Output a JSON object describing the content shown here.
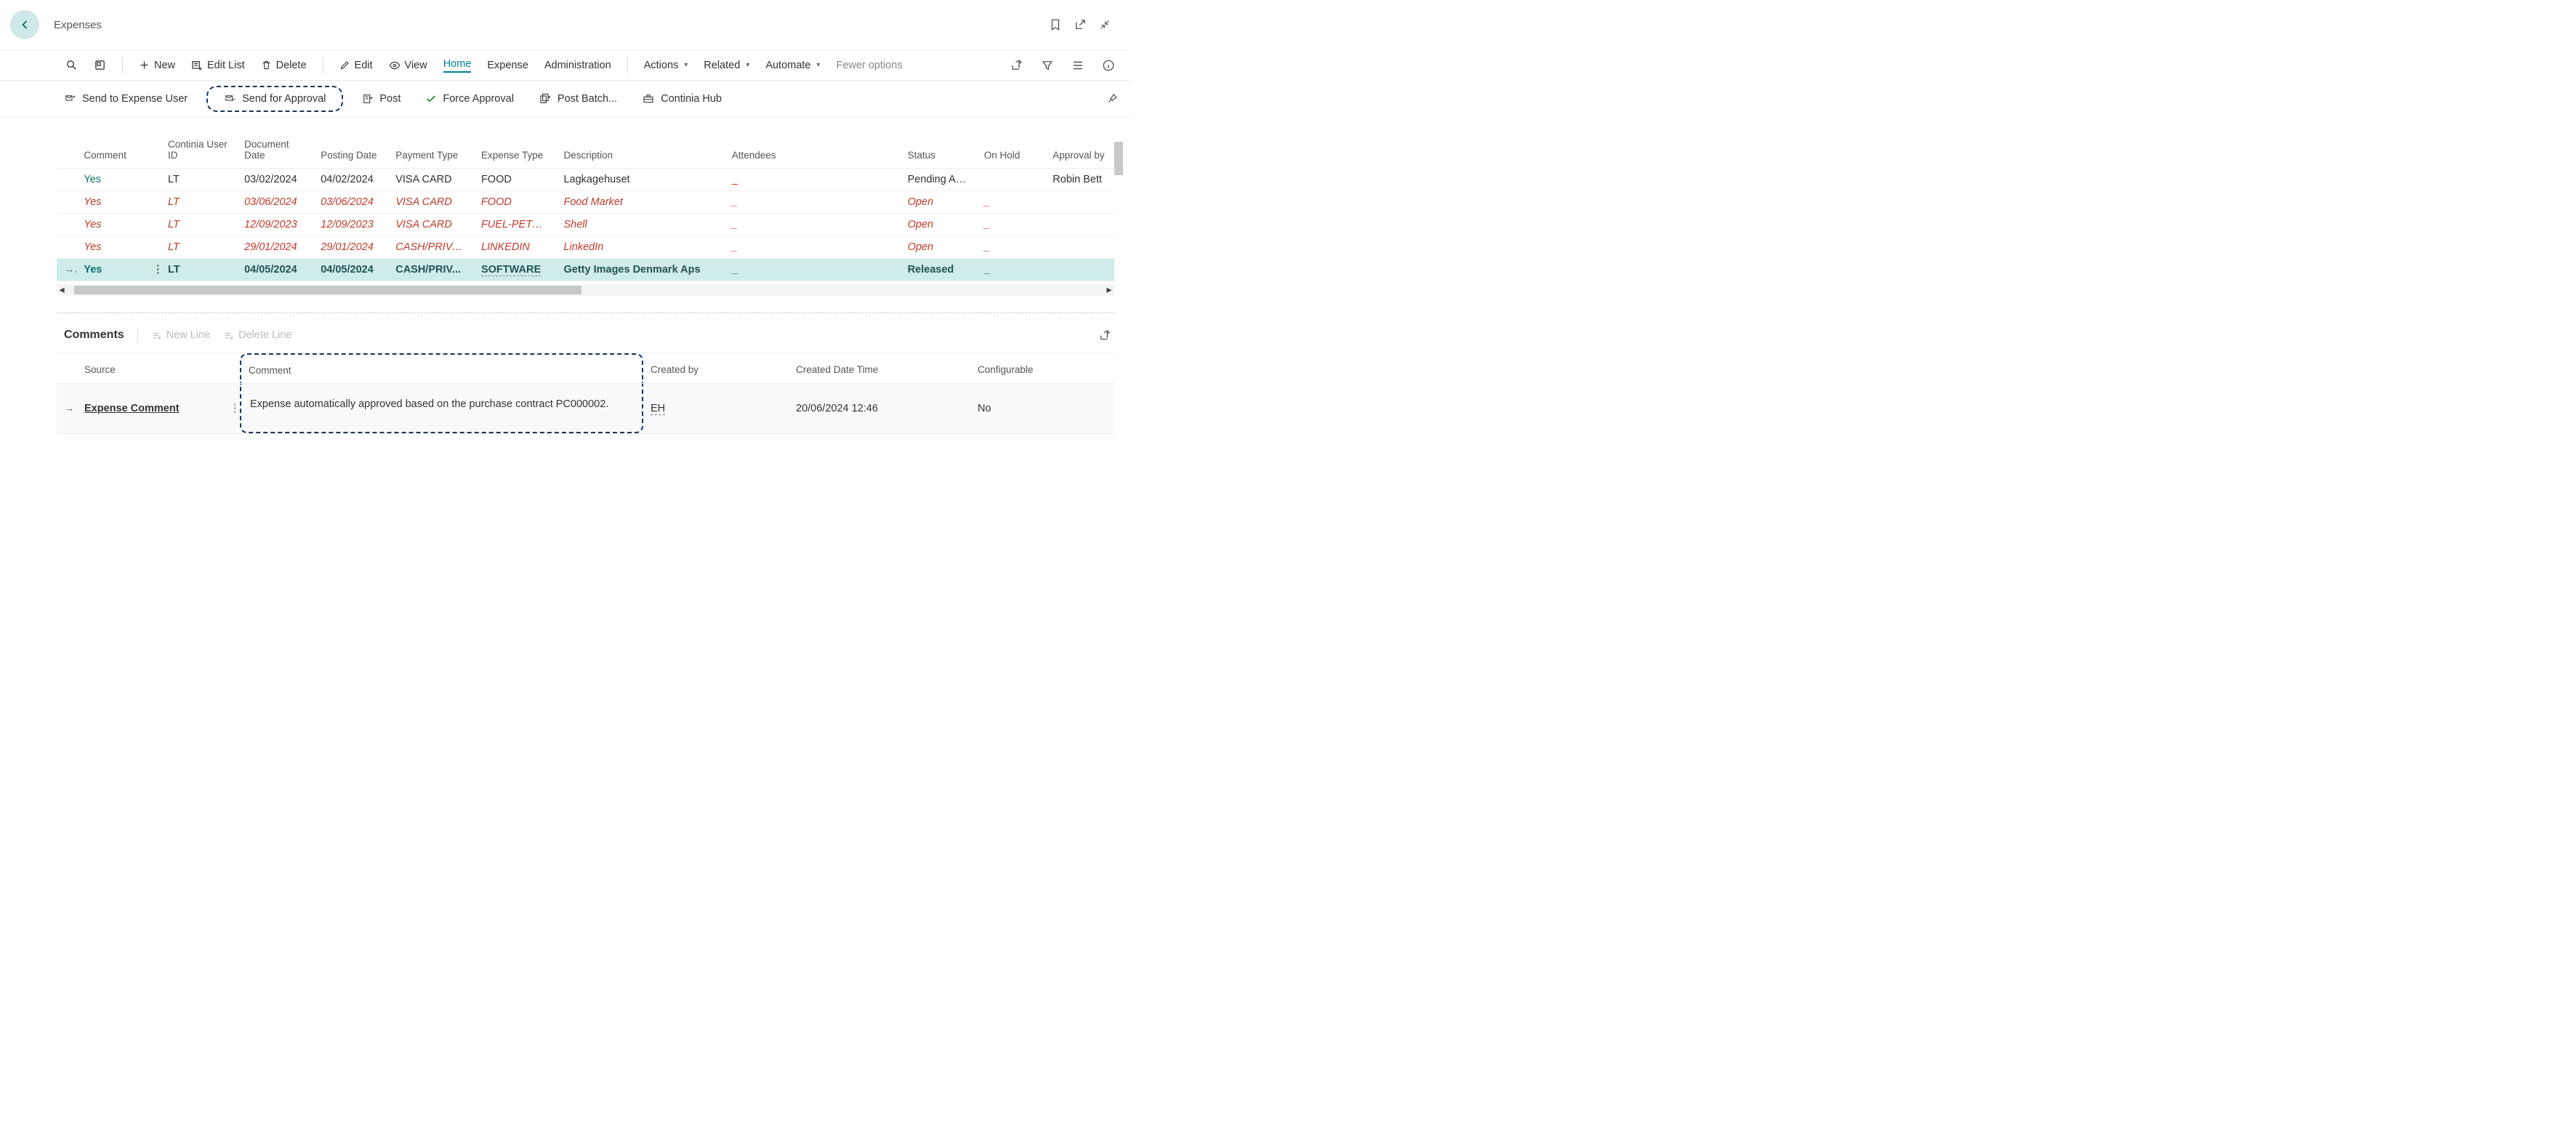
{
  "titlebar": {
    "title": "Expenses"
  },
  "ribbon1": {
    "new": "New",
    "edit_list": "Edit List",
    "delete": "Delete",
    "edit": "Edit",
    "view": "View",
    "home": "Home",
    "expense": "Expense",
    "administration": "Administration",
    "actions": "Actions",
    "related": "Related",
    "automate": "Automate",
    "fewer": "Fewer options"
  },
  "ribbon2": {
    "send_user": "Send to Expense User",
    "send_approval": "Send for Approval",
    "post": "Post",
    "force_approval": "Force Approval",
    "post_batch": "Post Batch...",
    "continia_hub": "Continia Hub"
  },
  "columns": {
    "comment": "Comment",
    "user_id": "Continia User ID",
    "doc_date": "Document Date",
    "posting_date": "Posting Date",
    "payment_type": "Payment Type",
    "expense_type": "Expense Type",
    "description": "Description",
    "attendees": "Attendees",
    "status": "Status",
    "on_hold": "On Hold",
    "approval_by": "Approval by"
  },
  "rows": [
    {
      "style": "normal",
      "comment": "Yes",
      "user": "LT",
      "doc": "03/02/2024",
      "post": "04/02/2024",
      "pay": "VISA CARD",
      "etype": "FOOD",
      "desc": "Lagkagehuset",
      "att": "_",
      "status": "Pending Ap...",
      "hold": "",
      "appr": "Robin Bett"
    },
    {
      "style": "open",
      "comment": "Yes",
      "user": "LT",
      "doc": "03/06/2024",
      "post": "03/06/2024",
      "pay": "VISA CARD",
      "etype": "FOOD",
      "desc": "Food Market",
      "att": "_",
      "status": "Open",
      "hold": "_",
      "appr": ""
    },
    {
      "style": "open",
      "comment": "Yes",
      "user": "LT",
      "doc": "12/09/2023",
      "post": "12/09/2023",
      "pay": "VISA CARD",
      "etype": "FUEL-PETROL",
      "desc": "Shell",
      "att": "_",
      "status": "Open",
      "hold": "_",
      "appr": ""
    },
    {
      "style": "open",
      "comment": "Yes",
      "user": "LT",
      "doc": "29/01/2024",
      "post": "29/01/2024",
      "pay": "CASH/PRIVAT...",
      "etype": "LINKEDIN",
      "desc": "LinkedIn",
      "att": "_",
      "status": "Open",
      "hold": "_",
      "appr": ""
    },
    {
      "style": "selected",
      "comment": "Yes",
      "user": "LT",
      "doc": "04/05/2024",
      "post": "04/05/2024",
      "pay": "CASH/PRIV...",
      "etype": "SOFTWARE",
      "desc": "Getty Images Denmark Aps",
      "att": "_",
      "status": "Released",
      "hold": "_",
      "appr": ""
    }
  ],
  "comments_panel": {
    "title": "Comments",
    "new_line": "New Line",
    "delete_line": "Delete Line",
    "cols": {
      "source": "Source",
      "comment": "Comment",
      "created_by": "Created by",
      "created_dt": "Created Date Time",
      "configurable": "Configurable"
    },
    "row": {
      "source": "Expense Comment",
      "comment": "Expense automatically approved based on the purchase contract PC000002.",
      "created_by": "EH",
      "created_dt": "20/06/2024 12:46",
      "configurable": "No"
    }
  }
}
